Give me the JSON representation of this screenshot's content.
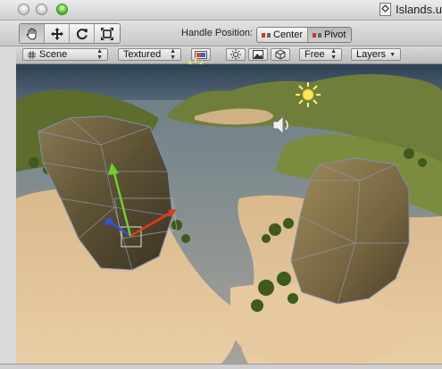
{
  "window": {
    "title": "Islands.u",
    "controls": [
      "close-button",
      "minimize-button",
      "zoom-button"
    ]
  },
  "toolbar": {
    "tools": [
      {
        "name": "hand-tool",
        "icon": "hand-icon",
        "active": true
      },
      {
        "name": "move-tool",
        "icon": "move-arrows-icon",
        "active": false
      },
      {
        "name": "rotate-tool",
        "icon": "rotate-icon",
        "active": false
      },
      {
        "name": "scale-tool",
        "icon": "scale-icon",
        "active": false
      }
    ],
    "handle_position_label": "Handle Position:",
    "center_label": "Center",
    "pivot_label": "Pivot",
    "pivot_active": true
  },
  "scene_bar": {
    "view_mode": "Scene",
    "render_mode": "Textured",
    "camera_mode": "Free",
    "layers_label": "Layers",
    "icons": [
      "color-icon",
      "lighting-icon",
      "image-icon",
      "cube-icon"
    ]
  },
  "viewport": {
    "colors": {
      "sky": "#3e5568",
      "water": "#7e8c92",
      "sand": "#e4c69a",
      "grass": "#7a8a3c"
    },
    "gizmo_colors": {
      "x_axis": "#e03a1e",
      "y_axis": "#6fcf2a",
      "z_axis": "#2a56d8"
    },
    "icons": [
      "sun-light-icon",
      "sun-light-icon",
      "audio-source-icon"
    ]
  }
}
